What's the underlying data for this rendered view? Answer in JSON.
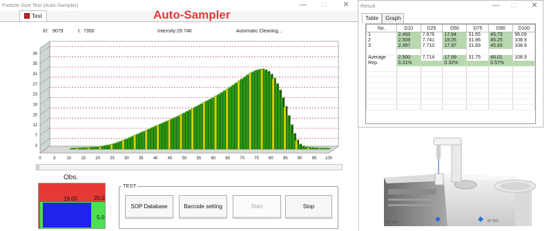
{
  "left_window": {
    "title": "Particle Size Test (Auto-Sampler)",
    "tab_label": "Test",
    "app_heading": "Auto-Sampler",
    "i0_label": "I0:",
    "i0_value": "9079",
    "i_label": "I:",
    "i_value": "7350",
    "intensity": "Intensity:29.74K",
    "status": "Automatic Cleaning..."
  },
  "window_controls": {
    "minimize": "—",
    "maximize": "□",
    "close": "✕"
  },
  "chart_data": {
    "type": "bar",
    "y_ticks": [
      3,
      7,
      11,
      15,
      19,
      23,
      27,
      31,
      35,
      39
    ],
    "x_ticks": [
      0,
      5,
      10,
      15,
      20,
      25,
      30,
      35,
      40,
      45,
      50,
      55,
      60,
      65,
      70,
      75,
      80,
      85,
      90,
      95,
      100
    ],
    "ylim": [
      0,
      41
    ],
    "xlim": [
      0,
      100
    ],
    "x": [
      10,
      11,
      12,
      13,
      14,
      15,
      16,
      17,
      18,
      19,
      20,
      21,
      22,
      23,
      24,
      25,
      26,
      27,
      28,
      29,
      30,
      31,
      32,
      33,
      34,
      35,
      36,
      37,
      38,
      39,
      40,
      41,
      42,
      43,
      44,
      45,
      46,
      47,
      48,
      49,
      50,
      51,
      52,
      53,
      54,
      55,
      56,
      57,
      58,
      59,
      60,
      61,
      62,
      63,
      64,
      65,
      66,
      67,
      68,
      69,
      70,
      71,
      72,
      73,
      74,
      75,
      76,
      77,
      78,
      79,
      80,
      81,
      82,
      83,
      84,
      85,
      86,
      87,
      88,
      89,
      90,
      91,
      92,
      93,
      94,
      95,
      96,
      97,
      98,
      99
    ],
    "values": [
      0.3,
      0.35,
      0.4,
      0.45,
      0.5,
      0.55,
      0.6,
      0.7,
      0.8,
      0.9,
      1.0,
      1.2,
      1.4,
      1.6,
      1.9,
      2.2,
      2.6,
      3.0,
      3.4,
      3.9,
      4.4,
      4.9,
      5.4,
      5.9,
      6.4,
      6.9,
      7.4,
      7.9,
      8.4,
      8.9,
      9.4,
      9.9,
      10.4,
      10.9,
      11.4,
      11.9,
      12.4,
      12.9,
      13.5,
      14.1,
      14.7,
      15.3,
      15.9,
      16.5,
      17.1,
      17.7,
      18.3,
      18.9,
      19.5,
      20.1,
      20.7,
      21.4,
      22.1,
      22.8,
      23.5,
      24.2,
      25.0,
      25.8,
      26.6,
      27.4,
      28.2,
      29.0,
      29.7,
      30.3,
      30.8,
      31.1,
      31.2,
      30.9,
      30.3,
      29.2,
      27.6,
      25.5,
      23.0,
      20.0,
      16.6,
      13.0,
      9.4,
      6.0,
      3.4,
      1.8,
      1.1,
      0.8,
      0.6,
      0.5,
      0.45,
      0.4,
      0.35,
      0.3,
      0.3,
      0.25
    ],
    "grid": true,
    "colors": {
      "bar": "#2a9a12",
      "bar_dark": "#134d08",
      "bar_alt": "#d4d400",
      "grid": "#c0403d"
    }
  },
  "obs": {
    "label": "Obs.",
    "value_top": "19.05",
    "value_top_right": "20.0",
    "value_bottom_right": "5.0"
  },
  "test_group": {
    "label": "TEST",
    "buttons": [
      "SOP Database",
      "Barcode setting",
      "Start",
      "Stop"
    ]
  },
  "right_window": {
    "title": "Result",
    "tabs": [
      "Table",
      "Graph"
    ],
    "columns": [
      "No.",
      "D10",
      "D25",
      "D50",
      "D75",
      "D90",
      "D100"
    ],
    "rows": [
      [
        "1",
        "2.493",
        "7.676",
        "17.94",
        "31.65",
        "45.73",
        "96.09"
      ],
      [
        "2",
        "2.508",
        "7.741",
        "18.05",
        "31.86",
        "46.25",
        "108.9"
      ],
      [
        "3",
        "2.497",
        "7.710",
        "17.97",
        "31.69",
        "45.93",
        "108.9"
      ]
    ],
    "average_row": [
      "Average",
      "2.500",
      "7.714",
      "17.99",
      "31.75",
      "46.01",
      "108.9"
    ],
    "rep_row": [
      "Rep.",
      "0.31%",
      "",
      "0.32%",
      "",
      "0.57%",
      ""
    ]
  },
  "instrument": {
    "label_left": "BT-800",
    "label_right": "BT-800"
  }
}
